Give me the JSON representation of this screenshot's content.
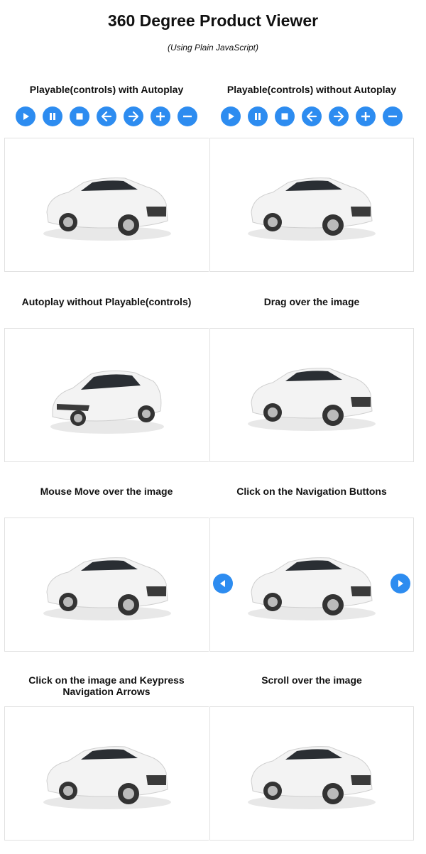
{
  "header": {
    "title": "360 Degree Product Viewer",
    "subtitle": "(Using Plain JavaScript)"
  },
  "colors": {
    "accent": "#2d8cf0",
    "border": "#e1e1e1",
    "car_body": "#f2f2f2",
    "car_glass": "#2a2e33"
  },
  "controls": [
    {
      "name": "play-icon"
    },
    {
      "name": "pause-icon"
    },
    {
      "name": "stop-icon"
    },
    {
      "name": "arrow-left-icon"
    },
    {
      "name": "arrow-right-icon"
    },
    {
      "name": "zoom-in-icon"
    },
    {
      "name": "zoom-out-icon"
    }
  ],
  "viewers": [
    {
      "title": "Playable(controls) with Autoplay"
    },
    {
      "title": "Playable(controls) without Autoplay"
    },
    {
      "title": "Autoplay without Playable(controls)"
    },
    {
      "title": "Drag over the image"
    },
    {
      "title": "Mouse Move over the image"
    },
    {
      "title": "Click on the Navigation Buttons"
    },
    {
      "title": "Click on the image and Keypress Navigation Arrows"
    },
    {
      "title": "Scroll over the image"
    }
  ],
  "product_image": {
    "alt": "White hatchback car"
  }
}
